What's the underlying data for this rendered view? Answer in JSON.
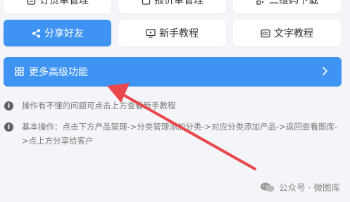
{
  "top_row": [
    {
      "label": "订货单管理",
      "icon": "order-icon"
    },
    {
      "label": "报价单管理",
      "icon": "quote-icon"
    },
    {
      "label": "二维码下载",
      "icon": "qrcode-icon"
    }
  ],
  "second_row": [
    {
      "label": "分享好友",
      "icon": "share-icon"
    },
    {
      "label": "新手教程",
      "icon": "monitor-play-icon"
    },
    {
      "label": "文字教程",
      "icon": "text-doc-icon"
    }
  ],
  "more": {
    "label": "更多高级功能",
    "icon": "grid-icon",
    "chevron": "chevron-right-icon"
  },
  "info": [
    {
      "text": "操作有不懂的问题可点击上方查看新手教程"
    },
    {
      "text": "基本操作：点击下方产品管理->分类管理添加分类->对应分类添加产品->返回查看图库->点上方分享给客户"
    }
  ],
  "watermark": {
    "text": "公众号 · 微图库",
    "icon": "wechat-icon"
  },
  "colors": {
    "primary": "#3f94f3",
    "background": "#f4f5f9",
    "arrow": "#e8474b"
  }
}
